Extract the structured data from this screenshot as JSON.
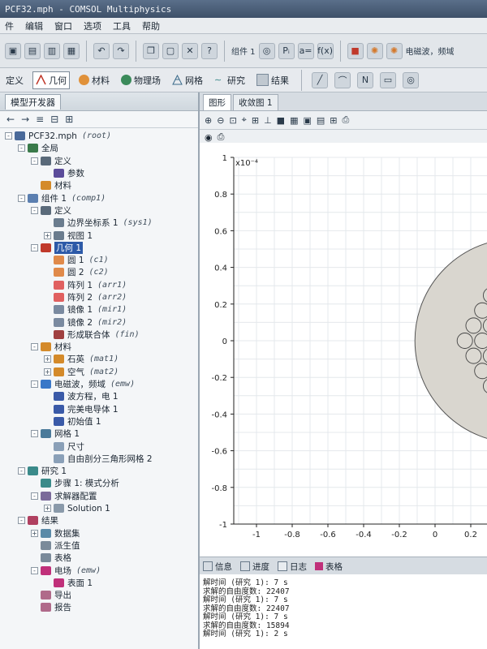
{
  "app": {
    "title": "PCF32.mph - COMSOL Multiphysics"
  },
  "menu": [
    "件",
    "编辑",
    "窗口",
    "选项",
    "工具",
    "帮助"
  ],
  "toolbar": {
    "combo1": "组件 1",
    "status_text": "电磁波，频域"
  },
  "ribbon": [
    "定义",
    "几何",
    "材料",
    "物理场",
    "网格",
    "研究",
    "结果"
  ],
  "left_panel": {
    "title": "模型开发器"
  },
  "tree": [
    {
      "label": "PCF32.mph",
      "tag": "(root)",
      "indent": 0,
      "exp": "-",
      "color": "#4a6a9a"
    },
    {
      "label": "全局",
      "tag": "",
      "indent": 1,
      "exp": "-",
      "color": "#3a7a4a"
    },
    {
      "label": "定义",
      "tag": "",
      "indent": 2,
      "exp": "-",
      "color": "#5a6a7a"
    },
    {
      "label": "参数",
      "tag": "",
      "indent": 3,
      "exp": "",
      "color": "#5b4c9a",
      "prefix": "Pi"
    },
    {
      "label": "材料",
      "tag": "",
      "indent": 2,
      "exp": "",
      "color": "#d48a2a"
    },
    {
      "label": "组件 1",
      "tag": "(comp1)",
      "indent": 1,
      "exp": "-",
      "color": "#5b7fb0"
    },
    {
      "label": "定义",
      "tag": "",
      "indent": 2,
      "exp": "-",
      "color": "#5a6a7a"
    },
    {
      "label": "边界坐标系 1",
      "tag": "(sys1)",
      "indent": 3,
      "exp": "",
      "color": "#6a7c8e"
    },
    {
      "label": "视图 1",
      "tag": "",
      "indent": 3,
      "exp": "+",
      "color": "#6a7c8e"
    },
    {
      "label": "几何 1",
      "tag": "",
      "indent": 2,
      "exp": "-",
      "color": "#c0392b",
      "selected": true
    },
    {
      "label": "圆 1",
      "tag": "(c1)",
      "indent": 3,
      "exp": "",
      "color": "#e08a4a"
    },
    {
      "label": "圆 2",
      "tag": "(c2)",
      "indent": 3,
      "exp": "",
      "color": "#e08a4a"
    },
    {
      "label": "阵列 1",
      "tag": "(arr1)",
      "indent": 3,
      "exp": "",
      "color": "#e06060"
    },
    {
      "label": "阵列 2",
      "tag": "(arr2)",
      "indent": 3,
      "exp": "",
      "color": "#e06060"
    },
    {
      "label": "镜像 1",
      "tag": "(mir1)",
      "indent": 3,
      "exp": "",
      "color": "#7a8aa0"
    },
    {
      "label": "镜像 2",
      "tag": "(mir2)",
      "indent": 3,
      "exp": "",
      "color": "#7a8aa0"
    },
    {
      "label": "形成联合体",
      "tag": "(fin)",
      "indent": 3,
      "exp": "",
      "color": "#a04040"
    },
    {
      "label": "材料",
      "tag": "",
      "indent": 2,
      "exp": "-",
      "color": "#d48a2a"
    },
    {
      "label": "石英",
      "tag": "(mat1)",
      "indent": 3,
      "exp": "+",
      "color": "#d48a2a"
    },
    {
      "label": "空气",
      "tag": "(mat2)",
      "indent": 3,
      "exp": "+",
      "color": "#d48a2a"
    },
    {
      "label": "电磁波，频域",
      "tag": "(emw)",
      "indent": 2,
      "exp": "-",
      "color": "#3a78c8"
    },
    {
      "label": "波方程，电 1",
      "tag": "",
      "indent": 3,
      "exp": "",
      "color": "#3a5aa8"
    },
    {
      "label": "完美电导体 1",
      "tag": "",
      "indent": 3,
      "exp": "",
      "color": "#3a5aa8"
    },
    {
      "label": "初始值 1",
      "tag": "",
      "indent": 3,
      "exp": "",
      "color": "#3a5aa8"
    },
    {
      "label": "网格 1",
      "tag": "",
      "indent": 2,
      "exp": "-",
      "color": "#4a7a9a"
    },
    {
      "label": "尺寸",
      "tag": "",
      "indent": 3,
      "exp": "",
      "color": "#8aa0b8"
    },
    {
      "label": "自由剖分三角形网格 2",
      "tag": "",
      "indent": 3,
      "exp": "",
      "color": "#8aa0b8"
    },
    {
      "label": "研究 1",
      "tag": "",
      "indent": 1,
      "exp": "-",
      "color": "#3a8a8a"
    },
    {
      "label": "步骤 1: 模式分析",
      "tag": "",
      "indent": 2,
      "exp": "",
      "color": "#3a8a8a"
    },
    {
      "label": "求解器配置",
      "tag": "",
      "indent": 2,
      "exp": "-",
      "color": "#7a6a9a"
    },
    {
      "label": "Solution 1",
      "tag": "",
      "indent": 3,
      "exp": "+",
      "color": "#8a9aaa"
    },
    {
      "label": "结果",
      "tag": "",
      "indent": 1,
      "exp": "-",
      "color": "#b04060"
    },
    {
      "label": "数据集",
      "tag": "",
      "indent": 2,
      "exp": "+",
      "color": "#5a8aa8"
    },
    {
      "label": "派生值",
      "tag": "",
      "indent": 2,
      "exp": "",
      "color": "#7a8a9a"
    },
    {
      "label": "表格",
      "tag": "",
      "indent": 2,
      "exp": "",
      "color": "#7a8a9a"
    },
    {
      "label": "电场",
      "tag": "(emw)",
      "indent": 2,
      "exp": "-",
      "color": "#c0307a"
    },
    {
      "label": "表面 1",
      "tag": "",
      "indent": 3,
      "exp": "",
      "color": "#c0307a"
    },
    {
      "label": "导出",
      "tag": "",
      "indent": 2,
      "exp": "",
      "color": "#b06a8a"
    },
    {
      "label": "报告",
      "tag": "",
      "indent": 2,
      "exp": "",
      "color": "#b06a8a"
    }
  ],
  "graphics": {
    "tabs": [
      "图形",
      "收敛图 1"
    ],
    "exponent": "x10⁻⁴",
    "y_ticks": [
      "1",
      "0.8",
      "0.6",
      "0.4",
      "0.2",
      "0",
      "-0.2",
      "-0.4",
      "-0.6",
      "-0.8",
      "-1"
    ],
    "x_ticks": [
      "-1",
      "-0.8",
      "-0.6",
      "-0.4",
      "-0.2",
      "0",
      "0.2"
    ]
  },
  "messages": {
    "tabs": [
      "信息",
      "进度",
      "日志",
      "表格"
    ],
    "log": [
      "解时间 (研究 1): 7 s",
      "求解的自由度数: 22407",
      "解时间 (研究 1): 7 s",
      "求解的自由度数: 22407",
      "解时间 (研究 1): 7 s",
      "求解的自由度数: 15894",
      "解时间 (研究 1): 2 s"
    ]
  }
}
